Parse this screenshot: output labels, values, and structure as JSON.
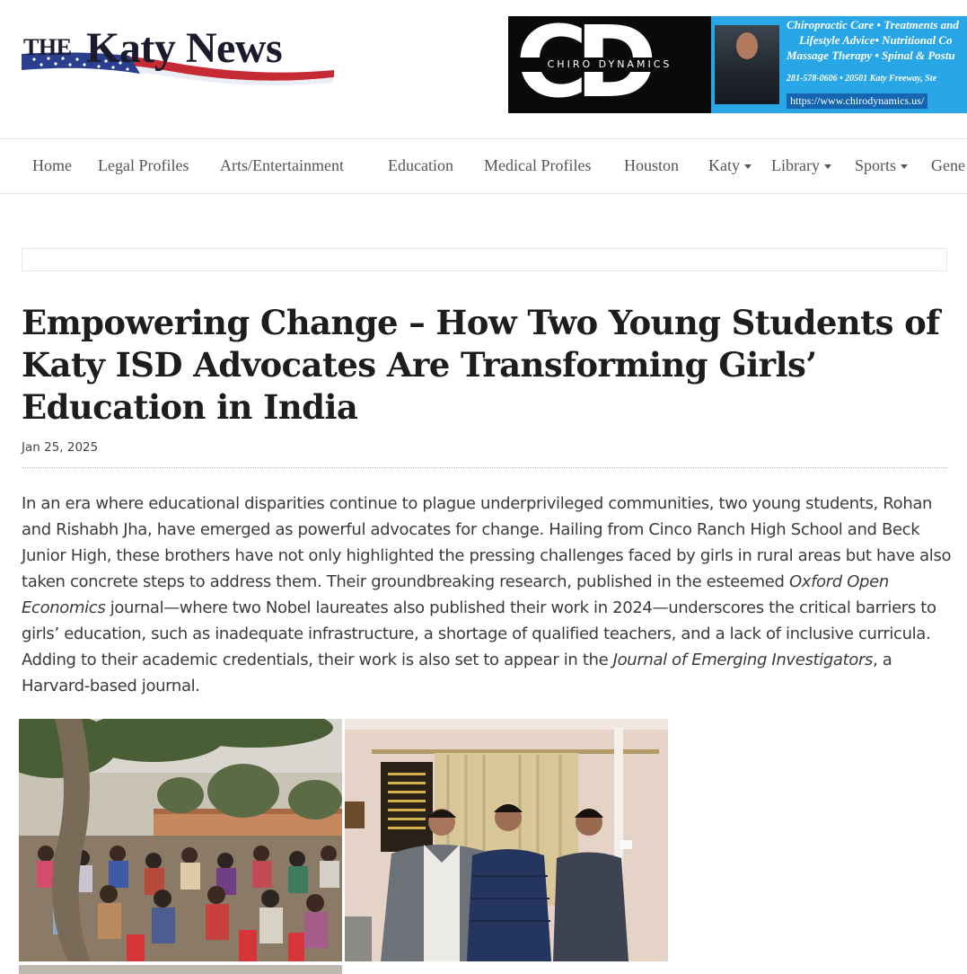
{
  "site": {
    "logo_the": "THE",
    "logo_name": "Katy News"
  },
  "ad": {
    "brand": "CHIRO DYNAMICS",
    "letters": "CD",
    "line1": "Chiropractic Care • Treatments and",
    "line2": "Lifestyle Advice• Nutritional Co",
    "line3": "Massage Therapy • Spinal & Postu",
    "contact": "281-578-0606 • 20501 Katy Freeway, Ste",
    "url": "https://www.chirodynamics.us/"
  },
  "nav": {
    "items": [
      {
        "label": "Home"
      },
      {
        "label": "Legal Profiles"
      },
      {
        "label": "Arts/Entertainment"
      },
      {
        "label": "Education"
      },
      {
        "label": "Medical Profiles"
      },
      {
        "label": "Houston"
      },
      {
        "label": "Katy"
      },
      {
        "label": "Library"
      },
      {
        "label": "Sports"
      },
      {
        "label": "Gene"
      }
    ]
  },
  "article": {
    "title": "Empowering Change – How Two Young Students of Katy ISD Advocates Are Transforming Girls’ Education in India",
    "date": "Jan 25, 2025",
    "p1_a": "In an era where educational disparities continue to plague underprivileged communities, two young students, Rohan and Rishabh Jha, have emerged as powerful advocates for change. Hailing from Cinco Ranch High School and Beck Junior High, these brothers have not only highlighted the pressing challenges faced by girls in rural areas but have also taken concrete steps to address them. Their groundbreaking research, published in the esteemed ",
    "p1_journal1": "Oxford Open Economics",
    "p1_b": " journal—where two Nobel laureates also published their work in 2024—underscores the critical barriers to girls’ education, such as inadequate infrastructure, a shortage of qualified teachers, and a lack of inclusive curricula. Adding to their academic credentials, their work is also set to appear in the ",
    "p1_journal2": "Journal of Emerging Investigators",
    "p1_c": ", a Harvard-based journal."
  },
  "colors": {
    "ad_blue": "#29a6e5",
    "ad_black": "#0a0a0a",
    "logo_navy": "#1b1b2e",
    "nav_text": "#555555"
  }
}
